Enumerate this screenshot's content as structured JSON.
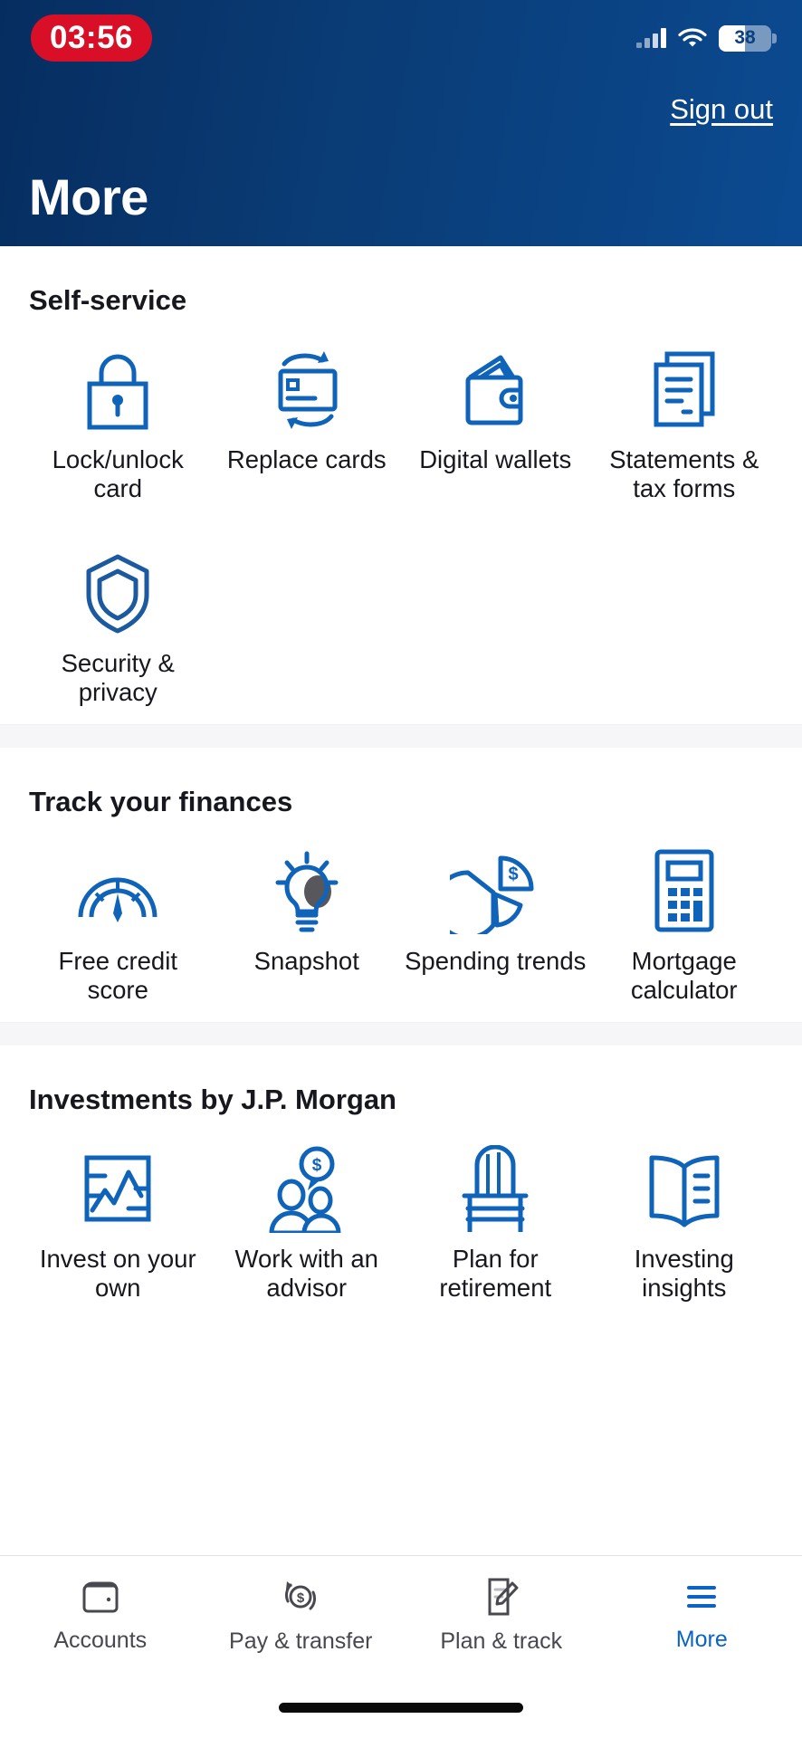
{
  "statusbar": {
    "time": "03:56",
    "battery_level": "38",
    "signal_icon": "cellular-signal-icon",
    "wifi_icon": "wifi-icon",
    "battery_icon": "battery-icon"
  },
  "header": {
    "title": "More",
    "sign_out": "Sign out",
    "bg_start": "#062d60",
    "bg_end": "#0b4a91"
  },
  "colors": {
    "icon_blue": "#0f63b8",
    "icon_dark_blue": "#1b5aa0",
    "accent": "#0b63c5",
    "text": "#16181d",
    "divider": "#f6f6f9"
  },
  "sections": [
    {
      "title": "Self-service",
      "items": [
        {
          "label": "Lock/unlock card",
          "icon": "padlock-icon"
        },
        {
          "label": "Replace cards",
          "icon": "card-refresh-icon"
        },
        {
          "label": "Digital wallets",
          "icon": "wallet-icon"
        },
        {
          "label": "Statements & tax forms",
          "icon": "documents-icon"
        },
        {
          "label": "Security & privacy",
          "icon": "shield-icon"
        }
      ]
    },
    {
      "title": "Track your finances",
      "items": [
        {
          "label": "Free credit score",
          "icon": "gauge-icon"
        },
        {
          "label": "Snapshot",
          "icon": "lightbulb-icon"
        },
        {
          "label": "Spending trends",
          "icon": "pie-chart-dollar-icon"
        },
        {
          "label": "Mortgage calculator",
          "icon": "calculator-icon"
        }
      ]
    },
    {
      "title": "Investments by J.P. Morgan",
      "items": [
        {
          "label": "Invest on your own",
          "icon": "line-chart-icon"
        },
        {
          "label": "Work with an advisor",
          "icon": "people-dollar-icon"
        },
        {
          "label": "Plan for retirement",
          "icon": "chair-icon"
        },
        {
          "label": "Investing insights",
          "icon": "open-book-icon"
        }
      ]
    }
  ],
  "bottom_nav": [
    {
      "label": "Accounts",
      "icon": "wallet-nav-icon",
      "active": false
    },
    {
      "label": "Pay & transfer",
      "icon": "dollar-refresh-icon",
      "active": false
    },
    {
      "label": "Plan & track",
      "icon": "document-pen-icon",
      "active": false
    },
    {
      "label": "More",
      "icon": "hamburger-icon",
      "active": true
    }
  ]
}
